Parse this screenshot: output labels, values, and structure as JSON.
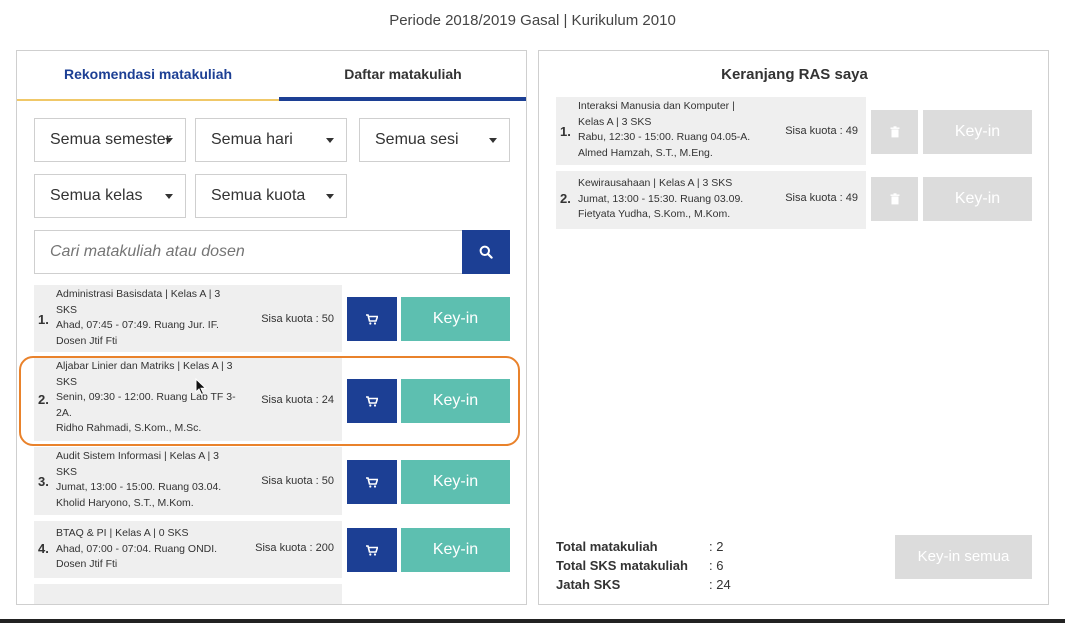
{
  "header": {
    "period": "Periode 2018/2019 Gasal | Kurikulum 2010"
  },
  "tabs": [
    {
      "label": "Rekomendasi matakuliah"
    },
    {
      "label": "Daftar matakuliah"
    }
  ],
  "filters": {
    "semester": "Semua semester",
    "hari": "Semua hari",
    "sesi": "Semua sesi",
    "kelas": "Semua kelas",
    "kuota": "Semua kuota"
  },
  "search": {
    "placeholder": "Cari matakuliah atau dosen"
  },
  "courses": [
    {
      "num": "1.",
      "title": "Administrasi Basisdata | Kelas A | 3 SKS",
      "schedule": "Ahad, 07:45 - 07:49. Ruang Jur. IF.",
      "lecturer": "Dosen Jtif Fti",
      "quota": "Sisa kuota : 50",
      "keyin": "Key-in"
    },
    {
      "num": "2.",
      "title": "Aljabar Linier dan Matriks | Kelas A | 3 SKS",
      "schedule": "Senin, 09:30 - 12:00. Ruang Lab TF 3-2A.",
      "lecturer": "Ridho Rahmadi, S.Kom., M.Sc.",
      "quota": "Sisa kuota : 24",
      "keyin": "Key-in"
    },
    {
      "num": "3.",
      "title": "Audit Sistem Informasi | Kelas A | 3 SKS",
      "schedule": "Jumat, 13:00 - 15:00. Ruang 03.04.",
      "lecturer": "Kholid Haryono, S.T., M.Kom.",
      "quota": "Sisa kuota : 50",
      "keyin": "Key-in"
    },
    {
      "num": "4.",
      "title": "BTAQ & PI | Kelas A | 0 SKS",
      "schedule": "Ahad, 07:00 - 07:04. Ruang ONDI.",
      "lecturer": "Dosen Jtif Fti",
      "quota": "Sisa kuota : 200",
      "keyin": "Key-in"
    }
  ],
  "basket": {
    "title": "Keranjang RAS saya",
    "items": [
      {
        "num": "1.",
        "title": "Interaksi Manusia dan Komputer | Kelas A | 3 SKS",
        "schedule": "Rabu, 12:30 - 15:00. Ruang 04.05-A.",
        "lecturer": "Almed Hamzah, S.T., M.Eng.",
        "quota": "Sisa kuota : 49",
        "keyin": "Key-in"
      },
      {
        "num": "2.",
        "title": "Kewirausahaan | Kelas A | 3 SKS",
        "schedule": "Jumat, 13:00 - 15:30. Ruang 03.09.",
        "lecturer": "Fietyata Yudha, S.Kom., M.Kom.",
        "quota": "Sisa kuota : 49",
        "keyin": "Key-in"
      }
    ],
    "totals": [
      {
        "label": "Total matakuliah",
        "value": ": 2"
      },
      {
        "label": "Total SKS matakuliah",
        "value": ": 6"
      },
      {
        "label": "Jatah SKS",
        "value": ": 24"
      }
    ],
    "keyin_all": "Key-in semua"
  },
  "icons": {
    "search": "search-icon",
    "cart": "cart-icon",
    "trash": "trash-icon",
    "cursor": "mouse-pointer-icon"
  },
  "colors": {
    "primary": "#1c3f94",
    "accent": "#5dbfb0",
    "disabled": "#dcdcdc",
    "highlight": "#e9822b"
  }
}
